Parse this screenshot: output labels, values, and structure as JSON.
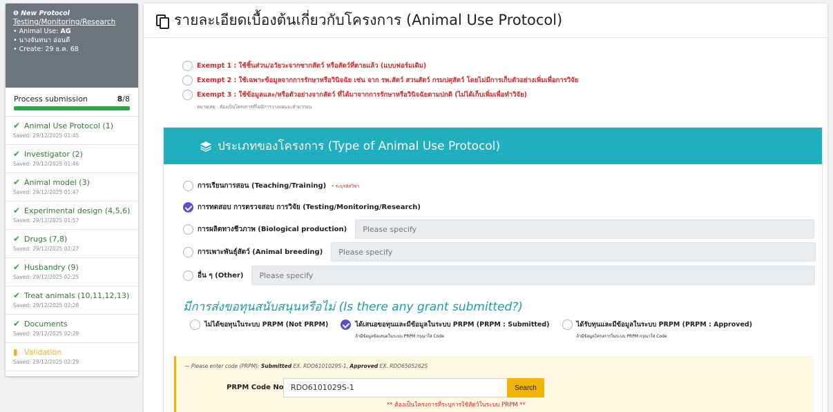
{
  "sidebar": {
    "head": {
      "title": "New Protocol",
      "link": "Testing/Monitoring/Research",
      "animal_use_label": "• Animal Use: ",
      "animal_use_value": "AG",
      "person": "• นางจันทนา อ่อนดี",
      "created": "• Create: 29 ธ.ค. 68"
    },
    "progress": {
      "label": "Process submission",
      "done": "8",
      "total": "/8",
      "value": 1.0
    },
    "steps": [
      {
        "label": "Animal Use Protocol (1)",
        "saved": "Saved: 29/12/2025 01:45",
        "icon": "check-icon"
      },
      {
        "label": "Investigator (2)",
        "saved": "Saved: 29/12/2025 01:46",
        "icon": "check-icon"
      },
      {
        "label": "Animal model (3)",
        "saved": "Saved: 29/12/2025 01:47",
        "icon": "check-icon"
      },
      {
        "label": "Experimental design (4,5,6)",
        "saved": "Saved: 29/12/2025 01:57",
        "icon": "check-icon"
      },
      {
        "label": "Drugs (7,8)",
        "saved": "Saved: 29/12/2025 02:27",
        "icon": "check-icon"
      },
      {
        "label": "Husbandry (9)",
        "saved": "Saved: 29/12/2025 02:25",
        "icon": "check-icon"
      },
      {
        "label": "Treat animals (10,11,12,13)",
        "saved": "Saved: 29/12/2025 02:28",
        "icon": "check-icon"
      },
      {
        "label": "Documents",
        "saved": "Saved: 29/12/2025 02:29",
        "icon": "check-icon"
      },
      {
        "label": "Validation",
        "saved": "Saved: 29/12/2025 02:29",
        "icon": "file-warning-icon"
      }
    ]
  },
  "main": {
    "title": "รายละเอียดเบื้องต้นเกี่ยวกับโครงการ (Animal Use Protocol)",
    "exempt": [
      "Exempt 1 : ใช้ชิ้นส่วน/อวัยวะจากซากสัตว์ หรือสัตว์ที่ตายแล้ว (แบบฟอร์มเดิม)",
      "Exempt 2 : ใช้เฉพาะข้อมูลจากการรักษาหรือวินิจฉัย เช่น จาก รพ.สัตว์ สวนสัตว์ กรมปศุสัตว์ โดยไม่มีการเก็บตัวอย่างเพิ่มเพื่อการวิจัย",
      "Exempt 3 : ใช้ข้อมูลและ/หรือตัวอย่างจากสัตว์ ที่ได้มาจากการรักษาหรือวินิจฉัยตามปกติ (ไม่ได้เก็บเพิ่มเพื่อทำวิจัย)"
    ],
    "exempt_note": "หมายเหตุ : ต้องเป็นโครงการที่ไม่มีการวางแผนจะทำมาก่อน",
    "type_header": "ประเภทของโครงการ (Type of Animal Use Protocol)",
    "types": [
      {
        "label": "การเรียนการสอน (Teaching/Training)",
        "note": "* ระบุรหัสวิชา",
        "checked": false
      },
      {
        "label": "การทดสอบ การตรวจสอบ การวิจัย (Testing/Monitoring/Research)",
        "checked": true
      },
      {
        "label": "การผลิตทางชีวภาพ (Biological production)",
        "placeholder": "Please specify",
        "checked": false
      },
      {
        "label": "การเพาะพันธุ์สัตว์ (Animal breeding)",
        "placeholder": "Please specify",
        "checked": false
      },
      {
        "label": "อื่น ๆ (Other)",
        "placeholder": "Please specify",
        "checked": false
      }
    ],
    "grant_title": "มีการส่งขอทุนสนับสนุนหรือไม่ (Is there any grant submitted?)",
    "grants": [
      {
        "label": "ไม่ได้ขอทุนในระบบ PRPM (Not PRPM)",
        "sub": "",
        "checked": false
      },
      {
        "label": "ได้เสนอขอทุนและมีข้อมูลในระบบ PRPM (PRPM : Submitted)",
        "sub": "ถ้ามีข้อมูลข้อเสนอในระบบ PRPM กรุณาใส่ Code",
        "checked": true
      },
      {
        "label": "ได้รับทุนและมีข้อมูลในระบบ PRPM (PRPM : Approved)",
        "sub": "ถ้ามีข้อมูลโครงการในระบบ PRPM กรุณาใส่ Code",
        "checked": false
      }
    ],
    "code": {
      "hint_prefix": "— Please enter code (PRPM): ",
      "hint_sub_label": "Submitted",
      "hint_sub_ex": " EX. RDO6101029S-1, ",
      "hint_app_label": "Approved",
      "hint_app_ex": " EX. RDO6505262S",
      "label": "PRPM Code No.",
      "value": "RDO6101029S-1",
      "button": "Search",
      "warning": "** ต้องเป็นโครงการที่ระบุการใช้สัตว์ในระบบ PRPM **"
    }
  },
  "colors": {
    "accent": "#1fafbd",
    "success": "#28a745",
    "danger": "#d62828",
    "warning": "#f1b400",
    "check_fill": "#5a4fcf"
  }
}
